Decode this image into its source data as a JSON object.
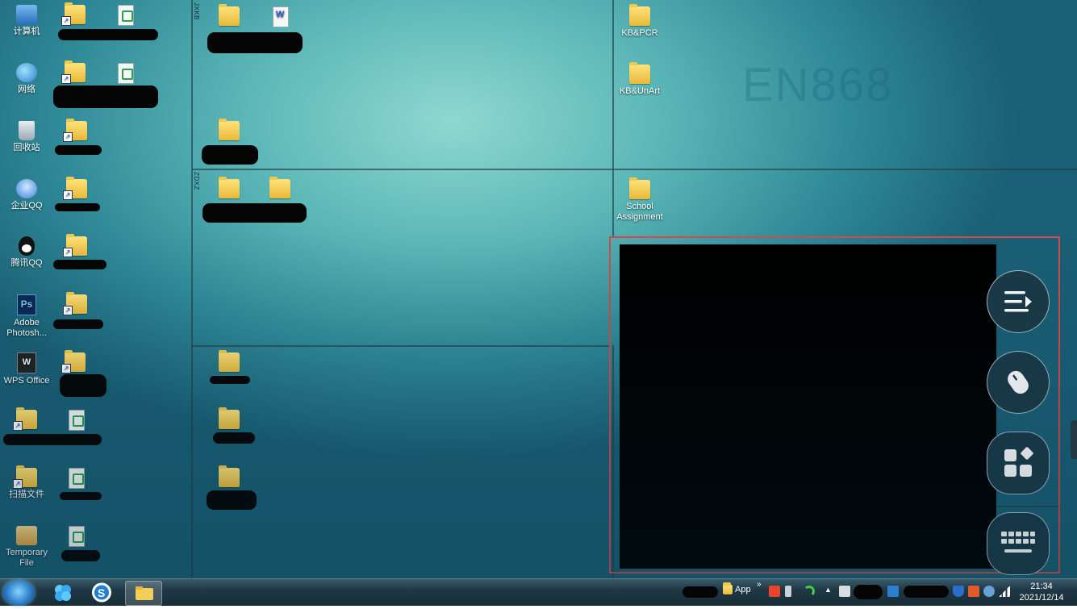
{
  "desktop": {
    "watermark": "EN868",
    "fences": [
      {
        "label": "JXKB"
      },
      {
        "label": "ZDXZ"
      }
    ],
    "left_icons": [
      {
        "label": "计算机",
        "icon": "computer-icon"
      },
      {
        "label": "网络",
        "icon": "network-icon"
      },
      {
        "label": "回收站",
        "icon": "recycle-bin-icon"
      },
      {
        "label": "企业QQ",
        "icon": "enterprise-qq-icon"
      },
      {
        "label": "腾讯QQ",
        "icon": "tencent-qq-icon"
      },
      {
        "label": "Adobe Photosh...",
        "icon": "photoshop-icon",
        "glyph": "Ps"
      },
      {
        "label": "WPS Office",
        "icon": "wps-office-icon",
        "glyph": "W"
      },
      {
        "label": "扫描文件",
        "icon": "folder-shortcut-icon"
      },
      {
        "label": "Temporary File",
        "icon": "temporary-file-icon"
      }
    ],
    "right_icons": [
      {
        "label": "KB&PCR",
        "icon": "folder-icon"
      },
      {
        "label": "KB&UnArt",
        "icon": "folder-icon"
      },
      {
        "label": "School Assignment",
        "icon": "folder-icon"
      }
    ]
  },
  "overlay": {
    "buttons": [
      {
        "name": "menu-collapse-icon"
      },
      {
        "name": "mouse-icon"
      },
      {
        "name": "apps-icon"
      },
      {
        "name": "keyboard-icon"
      }
    ],
    "colors": {
      "highlight": "#d34a4a",
      "fab_bg": "#1b3a48"
    }
  },
  "taskbar": {
    "tray_label": "App",
    "tray_chevron": "»",
    "time": "21:34",
    "date": "2021/12/14"
  }
}
